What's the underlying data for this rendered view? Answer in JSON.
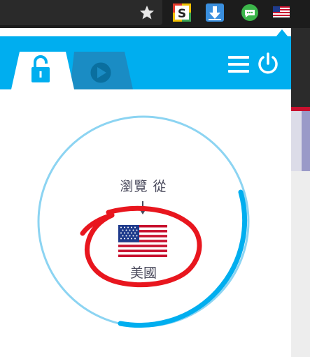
{
  "toolbar": {
    "icons": [
      "star-icon",
      "s-extension-icon",
      "download-icon",
      "chat-extension-icon",
      "us-flag-extension-icon"
    ]
  },
  "popup": {
    "tabs": [
      "lock-tab",
      "play-tab"
    ],
    "active_tab": "lock-tab",
    "header_color": "#00aeef"
  },
  "status": {
    "browse_from_label": "瀏覽 從",
    "country": "美國",
    "ring_color": "#00aeef",
    "annotation_color": "#e8161e"
  }
}
